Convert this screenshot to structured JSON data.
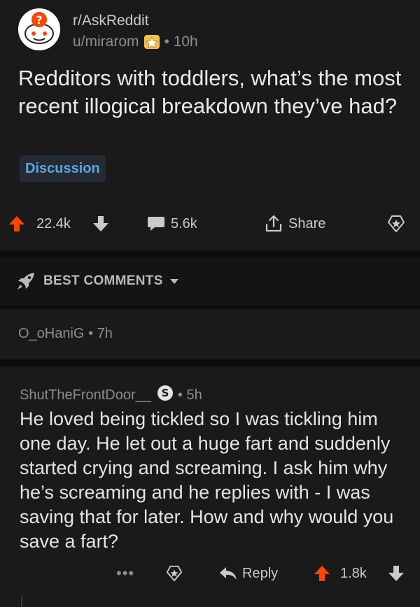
{
  "post": {
    "subreddit": "r/AskReddit",
    "author": "u/mirarom",
    "time": "• 10h",
    "title": "Redditors with toddlers, what’s the most recent illogical breakdown they’ve had?",
    "flair": "Discussion",
    "upvotes": "22.4k",
    "comments": "5.6k",
    "share_label": "Share"
  },
  "sort": {
    "label": "BEST COMMENTS"
  },
  "collapsed_comment": {
    "author": "O_oHaniG",
    "time": "• 7h"
  },
  "comment": {
    "author": "ShutTheFrontDoor__",
    "badge_letter": "S",
    "time": "• 5h",
    "body": "He loved being tickled so I was tickling him one day. He let out a huge fart and suddenly started crying and screaming. I ask him why he’s screaming and he replies with - I was saving that for later. How and why would you save a fart?",
    "more": "•••",
    "reply_label": "Reply",
    "upvotes": "1.8k"
  },
  "colors": {
    "background": "#1a1a1b",
    "upvote": "#ff4500",
    "flair_text": "#5aa7e0",
    "muted": "#8b8e90"
  },
  "icons": [
    "askreddit-avatar-icon",
    "award-badge-icon",
    "upvote-icon",
    "downvote-icon",
    "comment-icon",
    "share-icon",
    "save-icon",
    "rocket-icon",
    "chevron-down-icon",
    "subscriber-badge-icon",
    "more-icon",
    "reply-icon"
  ]
}
